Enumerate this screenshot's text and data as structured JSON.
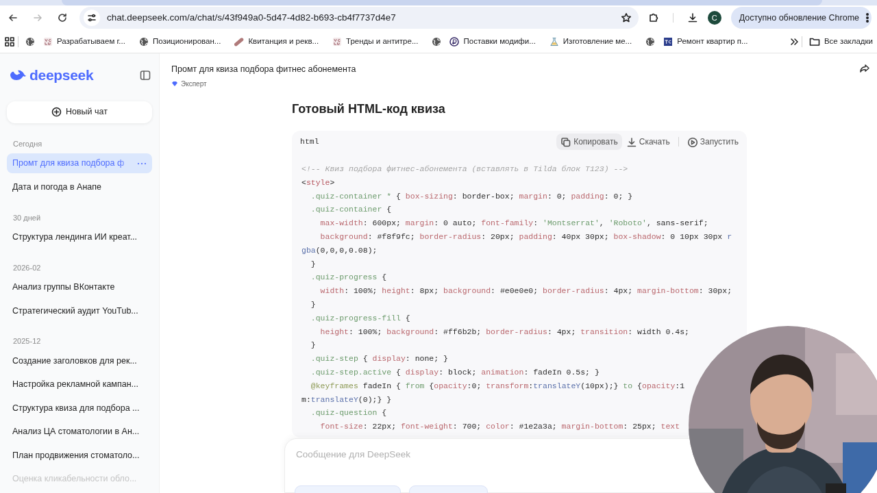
{
  "browser": {
    "url": "chat.deepseek.com/a/chat/s/43f949a0-5d47-4d82-b693-cb4f7737d4e7",
    "forward_disabled": true,
    "profile_initial": "C",
    "update_label": "Доступно обновление Chrome",
    "bookmarks": [
      {
        "kind": "globe"
      },
      {
        "kind": "vc",
        "label": "Разрабатываем г..."
      },
      {
        "kind": "globe",
        "label": "Позиционирован..."
      },
      {
        "kind": "capsule",
        "label": "Квитанция и рекв..."
      },
      {
        "kind": "vc",
        "label": "Тренды и антитре..."
      },
      {
        "kind": "globe"
      },
      {
        "kind": "coin",
        "label": "Поставки модифи..."
      },
      {
        "kind": "flask",
        "label": "Изготовление ме..."
      },
      {
        "kind": "globe"
      },
      {
        "kind": "tc",
        "label": "Ремонт квартир п..."
      }
    ],
    "all_bookmarks": "Все закладки"
  },
  "sidebar": {
    "logo": "deepseek",
    "new_chat": "Новый чат",
    "groups": [
      {
        "heading": "Сегодня",
        "items": [
          {
            "label": "Промт для квиза подбора ф",
            "selected": true,
            "faded": false
          },
          {
            "label": "Дата и погода в Анапе",
            "selected": false,
            "faded": false
          }
        ]
      },
      {
        "heading": "30 дней",
        "items": [
          {
            "label": "Структура лендинга ИИ креат...",
            "selected": false,
            "faded": false
          }
        ]
      },
      {
        "heading": "2026-02",
        "items": [
          {
            "label": "Анализ группы ВКонтакте",
            "selected": false,
            "faded": false
          },
          {
            "label": "Стратегический аудит YouTub...",
            "selected": false,
            "faded": false
          }
        ]
      },
      {
        "heading": "2025-12",
        "items": [
          {
            "label": "Создание заголовков для рек...",
            "selected": false,
            "faded": false
          },
          {
            "label": "Настройка рекламной кампан...",
            "selected": false,
            "faded": false
          },
          {
            "label": "Структура квиза для подбора ...",
            "selected": false,
            "faded": false
          },
          {
            "label": "Анализ ЦА стоматологии в Ан...",
            "selected": false,
            "faded": false
          },
          {
            "label": "План продвижения стоматоло...",
            "selected": false,
            "faded": false
          },
          {
            "label": "Оценка кликабельности обло...",
            "selected": false,
            "faded": true
          }
        ]
      }
    ]
  },
  "chat": {
    "title": "Промт для квиза подбора фитнес абонемента",
    "mode": "Эксперт",
    "heading": "Готовый HTML-код квиза",
    "code": {
      "language": "html",
      "actions": [
        {
          "kind": "copy",
          "label": "Копировать",
          "hovered": true
        },
        {
          "kind": "download",
          "label": "Скачать",
          "hovered": false
        },
        {
          "kind": "run",
          "label": "Запустить",
          "hovered": false
        }
      ],
      "lines": [
        [
          {
            "kind": "comment",
            "text": "<!-- Квиз подбора фитнес-абонемента (вставлять в Tilda блок T123) -->"
          }
        ],
        [
          {
            "kind": "plain",
            "text": "<"
          },
          {
            "kind": "tag",
            "text": "style"
          },
          {
            "kind": "plain",
            "text": ">"
          }
        ],
        [
          {
            "kind": "selector",
            "text": "  .quiz-container *"
          },
          {
            "kind": "plain",
            "text": " { "
          },
          {
            "kind": "property",
            "text": "box-sizing"
          },
          {
            "kind": "plain",
            "text": ": border-box; "
          },
          {
            "kind": "property",
            "text": "margin"
          },
          {
            "kind": "plain",
            "text": ": 0; "
          },
          {
            "kind": "property",
            "text": "padding"
          },
          {
            "kind": "plain",
            "text": ": 0; }"
          }
        ],
        [
          {
            "kind": "selector",
            "text": "  .quiz-container"
          },
          {
            "kind": "plain",
            "text": " {"
          }
        ],
        [
          {
            "kind": "property",
            "text": "    max-width"
          },
          {
            "kind": "plain",
            "text": ": 600px; "
          },
          {
            "kind": "property",
            "text": "margin"
          },
          {
            "kind": "plain",
            "text": ": 0 auto; "
          },
          {
            "kind": "property",
            "text": "font-family"
          },
          {
            "kind": "plain",
            "text": ": "
          },
          {
            "kind": "selector",
            "text": "'Montserrat'"
          },
          {
            "kind": "plain",
            "text": ", "
          },
          {
            "kind": "selector",
            "text": "'Roboto'"
          },
          {
            "kind": "plain",
            "text": ", sans-serif;"
          }
        ],
        [
          {
            "kind": "property",
            "text": "    background"
          },
          {
            "kind": "plain",
            "text": ": #f8f9fc; "
          },
          {
            "kind": "property",
            "text": "border-radius"
          },
          {
            "kind": "plain",
            "text": ": 20px; "
          },
          {
            "kind": "property",
            "text": "padding"
          },
          {
            "kind": "plain",
            "text": ": 40px 30px; "
          },
          {
            "kind": "property",
            "text": "box-shadow"
          },
          {
            "kind": "plain",
            "text": ": 0 10px 30px "
          },
          {
            "kind": "function",
            "text": "r"
          }
        ],
        [
          {
            "kind": "function",
            "text": "gba"
          },
          {
            "kind": "plain",
            "text": "(0,0,0,0.08);"
          }
        ],
        [
          {
            "kind": "plain",
            "text": "  }"
          }
        ],
        [
          {
            "kind": "selector",
            "text": "  .quiz-progress"
          },
          {
            "kind": "plain",
            "text": " {"
          }
        ],
        [
          {
            "kind": "property",
            "text": "    width"
          },
          {
            "kind": "plain",
            "text": ": 100%; "
          },
          {
            "kind": "property",
            "text": "height"
          },
          {
            "kind": "plain",
            "text": ": 8px; "
          },
          {
            "kind": "property",
            "text": "background"
          },
          {
            "kind": "plain",
            "text": ": #e0e0e0; "
          },
          {
            "kind": "property",
            "text": "border-radius"
          },
          {
            "kind": "plain",
            "text": ": 4px; "
          },
          {
            "kind": "property",
            "text": "margin-bottom"
          },
          {
            "kind": "plain",
            "text": ": 30px;"
          }
        ],
        [
          {
            "kind": "plain",
            "text": "  }"
          }
        ],
        [
          {
            "kind": "selector",
            "text": "  .quiz-progress-fill"
          },
          {
            "kind": "plain",
            "text": " {"
          }
        ],
        [
          {
            "kind": "property",
            "text": "    height"
          },
          {
            "kind": "plain",
            "text": ": 100%; "
          },
          {
            "kind": "property",
            "text": "background"
          },
          {
            "kind": "plain",
            "text": ": #ff6b2b; "
          },
          {
            "kind": "property",
            "text": "border-radius"
          },
          {
            "kind": "plain",
            "text": ": 4px; "
          },
          {
            "kind": "property",
            "text": "transition"
          },
          {
            "kind": "plain",
            "text": ": width 0.4s;"
          }
        ],
        [
          {
            "kind": "plain",
            "text": "  }"
          }
        ],
        [
          {
            "kind": "selector",
            "text": "  .quiz-step"
          },
          {
            "kind": "plain",
            "text": " { "
          },
          {
            "kind": "property",
            "text": "display"
          },
          {
            "kind": "plain",
            "text": ": none; }"
          }
        ],
        [
          {
            "kind": "selector",
            "text": "  .quiz-step.active"
          },
          {
            "kind": "plain",
            "text": " { "
          },
          {
            "kind": "property",
            "text": "display"
          },
          {
            "kind": "plain",
            "text": ": block; "
          },
          {
            "kind": "property",
            "text": "animation"
          },
          {
            "kind": "plain",
            "text": ": fadeIn 0.5s; }"
          }
        ],
        [
          {
            "kind": "keyword",
            "text": "  @keyframes"
          },
          {
            "kind": "plain",
            "text": " fadeIn { "
          },
          {
            "kind": "selector",
            "text": "from"
          },
          {
            "kind": "plain",
            "text": " {"
          },
          {
            "kind": "property",
            "text": "opacity"
          },
          {
            "kind": "plain",
            "text": ":0; "
          },
          {
            "kind": "property",
            "text": "transform"
          },
          {
            "kind": "plain",
            "text": ":"
          },
          {
            "kind": "function",
            "text": "translateY"
          },
          {
            "kind": "plain",
            "text": "(10px);} "
          },
          {
            "kind": "selector",
            "text": "to"
          },
          {
            "kind": "plain",
            "text": " {"
          },
          {
            "kind": "property",
            "text": "opacity"
          },
          {
            "kind": "plain",
            "text": ":1"
          }
        ],
        [
          {
            "kind": "plain",
            "text": "m:"
          },
          {
            "kind": "function",
            "text": "translateY"
          },
          {
            "kind": "plain",
            "text": "(0);} }"
          }
        ],
        [
          {
            "kind": "selector",
            "text": "  .quiz-question"
          },
          {
            "kind": "plain",
            "text": " {"
          }
        ],
        [
          {
            "kind": "property",
            "text": "    font-size"
          },
          {
            "kind": "plain",
            "text": ": 22px; "
          },
          {
            "kind": "property",
            "text": "font-weight"
          },
          {
            "kind": "plain",
            "text": ": 700; "
          },
          {
            "kind": "property",
            "text": "color"
          },
          {
            "kind": "plain",
            "text": ": #1e2a3a; "
          },
          {
            "kind": "property",
            "text": "margin-bottom"
          },
          {
            "kind": "plain",
            "text": ": 25px; "
          },
          {
            "kind": "property",
            "text": "text"
          }
        ]
      ]
    },
    "composer": {
      "placeholder": "Сообщение для DeepSeek"
    }
  }
}
